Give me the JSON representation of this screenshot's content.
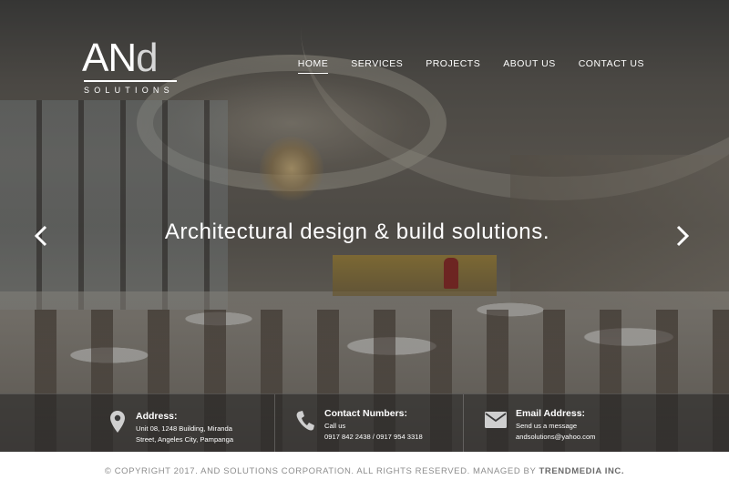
{
  "brand": {
    "logo_mark_an": "AN",
    "logo_mark_d": "d",
    "logo_subtitle": "SOLUTIONS"
  },
  "nav": {
    "items": [
      {
        "label": "HOME",
        "active": true
      },
      {
        "label": "SERVICES",
        "active": false
      },
      {
        "label": "PROJECTS",
        "active": false
      },
      {
        "label": "ABOUT US",
        "active": false
      },
      {
        "label": "CONTACT US",
        "active": false
      }
    ]
  },
  "hero": {
    "headline": "Architectural design & build solutions.",
    "prev_icon": "chevron-left-icon",
    "next_icon": "chevron-right-icon"
  },
  "contact": {
    "address": {
      "icon": "map-pin-icon",
      "title": "Address:",
      "line1": "Unit 08, 1248 Building, Miranda",
      "line2": "Street, Angeles City, Pampanga"
    },
    "phone": {
      "icon": "phone-icon",
      "title": "Contact Numbers:",
      "line1": "Call us",
      "line2": "0917 842 2438 / 0917 954 3318"
    },
    "email": {
      "icon": "envelope-icon",
      "title": "Email Address:",
      "line1": "Send us a message",
      "line2": "andsolutions@yahoo.com"
    }
  },
  "footer": {
    "copyright": "© COPYRIGHT 2017. AND SOLUTIONS CORPORATION. ALL RIGHTS RESERVED. MANAGED BY",
    "managed_by": "TRENDMEDIA INC."
  },
  "colors": {
    "text_light": "#ffffff",
    "footer_text": "#8c8c8c",
    "contact_bar": "#232323"
  }
}
